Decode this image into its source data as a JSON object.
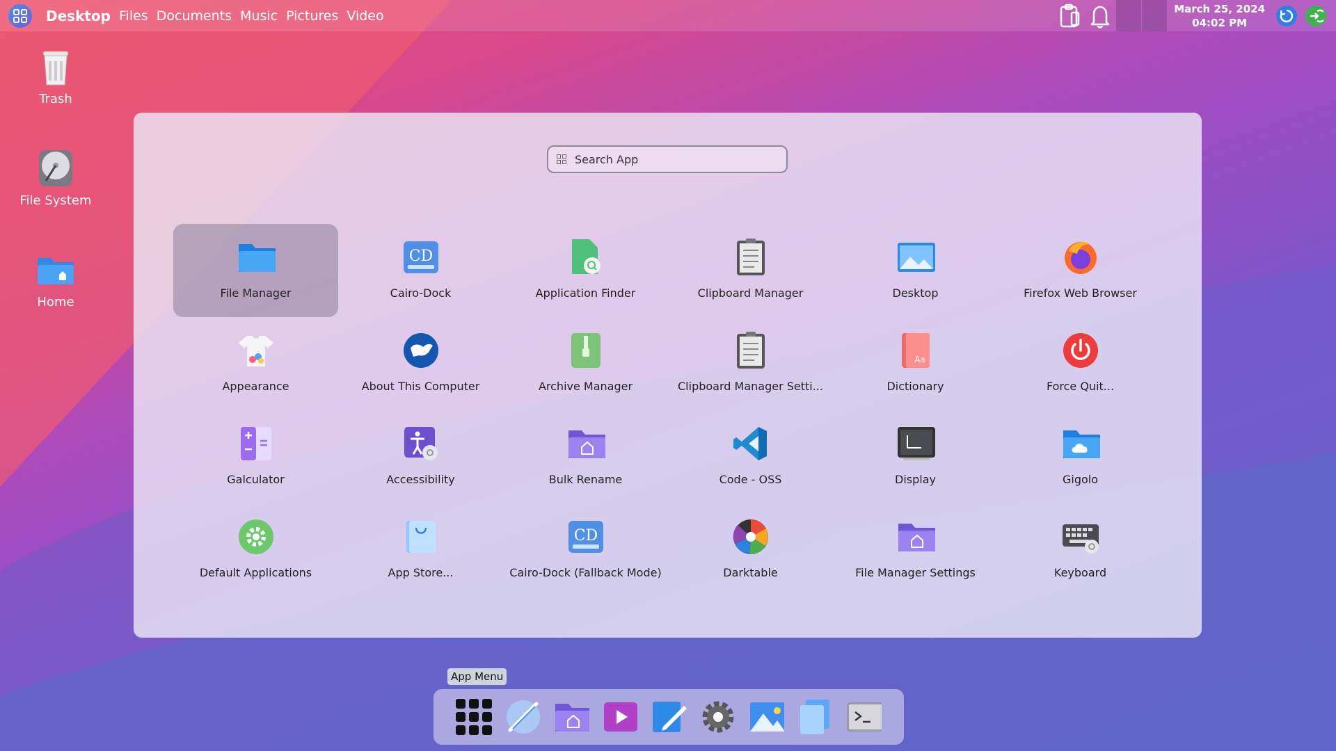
{
  "topbar": {
    "places": [
      "Desktop",
      "Files",
      "Documents",
      "Music",
      "Pictures",
      "Video"
    ],
    "active_place": "Desktop",
    "date": "March 25, 2024",
    "time": "04:02 PM"
  },
  "desktop_icons": [
    {
      "label": "Trash",
      "icon": "trash-icon"
    },
    {
      "label": "File System",
      "icon": "drive-icon"
    },
    {
      "label": "Home",
      "icon": "home-folder-icon"
    }
  ],
  "search": {
    "placeholder": "Search App"
  },
  "apps": [
    {
      "label": "File Manager",
      "icon": "folder-icon",
      "selected": true
    },
    {
      "label": "Cairo-Dock",
      "icon": "cairo-dock-icon"
    },
    {
      "label": "Application Finder",
      "icon": "app-finder-icon"
    },
    {
      "label": "Clipboard Manager",
      "icon": "clipboard-icon"
    },
    {
      "label": "Desktop",
      "icon": "desktop-icon"
    },
    {
      "label": "Firefox Web Browser",
      "icon": "firefox-icon"
    },
    {
      "label": "Appearance",
      "icon": "appearance-icon"
    },
    {
      "label": "About This Computer",
      "icon": "about-icon"
    },
    {
      "label": "Archive Manager",
      "icon": "archive-icon"
    },
    {
      "label": "Clipboard Manager Setti...",
      "icon": "clipboard-settings-icon"
    },
    {
      "label": "Dictionary",
      "icon": "dictionary-icon"
    },
    {
      "label": "Force Quit...",
      "icon": "power-icon"
    },
    {
      "label": "Galculator",
      "icon": "calculator-icon"
    },
    {
      "label": "Accessibility",
      "icon": "accessibility-icon"
    },
    {
      "label": "Bulk Rename",
      "icon": "bulk-rename-icon"
    },
    {
      "label": "Code - OSS",
      "icon": "vscode-icon"
    },
    {
      "label": "Display",
      "icon": "display-icon"
    },
    {
      "label": "Gigolo",
      "icon": "cloud-folder-icon"
    },
    {
      "label": "Default Applications",
      "icon": "gear-icon"
    },
    {
      "label": "App Store...",
      "icon": "shopping-bag-icon"
    },
    {
      "label": "Cairo-Dock (Fallback Mode)",
      "icon": "cairo-dock-icon"
    },
    {
      "label": "Darktable",
      "icon": "aperture-icon"
    },
    {
      "label": "File Manager Settings",
      "icon": "folder-settings-icon"
    },
    {
      "label": "Keyboard",
      "icon": "keyboard-icon"
    }
  ],
  "tooltip": "App Menu",
  "dock": [
    "app-grid-icon",
    "browser-icon",
    "files-icon",
    "video-player-icon",
    "text-editor-icon",
    "settings-icon",
    "image-viewer-icon",
    "documents-icon",
    "terminal-icon"
  ]
}
